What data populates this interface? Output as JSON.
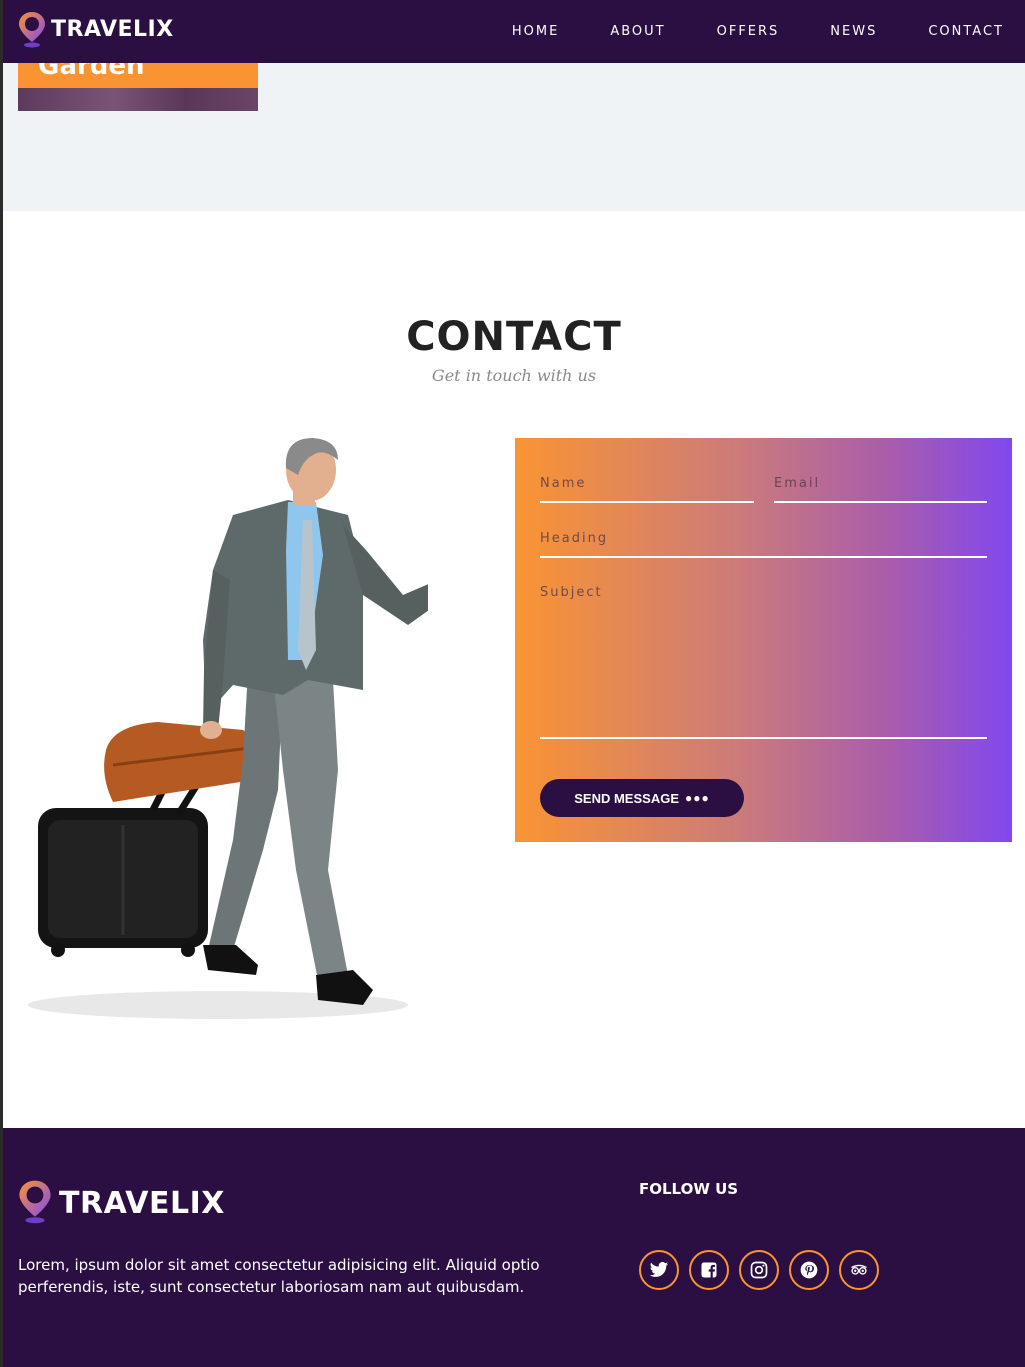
{
  "brand": {
    "name": "TRAVELIX"
  },
  "nav": {
    "items": [
      {
        "label": "HOME"
      },
      {
        "label": "ABOUT"
      },
      {
        "label": "OFFERS"
      },
      {
        "label": "NEWS"
      },
      {
        "label": "CONTACT"
      }
    ]
  },
  "offer_card": {
    "title": "Garden"
  },
  "contact": {
    "title": "CONTACT",
    "subtitle": "Get in touch with us",
    "form": {
      "name_placeholder": "Name",
      "email_placeholder": "Email",
      "heading_placeholder": "Heading",
      "subject_placeholder": "Subject",
      "send_label": "SEND MESSAGE",
      "send_dots": "●●●"
    }
  },
  "footer": {
    "brand": "TRAVELIX",
    "description": "Lorem, ipsum dolor sit amet consectetur adipisicing elit. Aliquid optio perferendis, iste, sunt consectetur laboriosam nam aut quibusdam.",
    "follow_title": "FOLLOW US",
    "socials": [
      "twitter-icon",
      "facebook-icon",
      "instagram-icon",
      "pinterest-icon",
      "tripadvisor-icon"
    ]
  },
  "colors": {
    "nav_bg": "#2c0f42",
    "accent_orange": "#fa9433",
    "accent_purple": "#8148ef",
    "light_bg": "#eff3f6"
  }
}
